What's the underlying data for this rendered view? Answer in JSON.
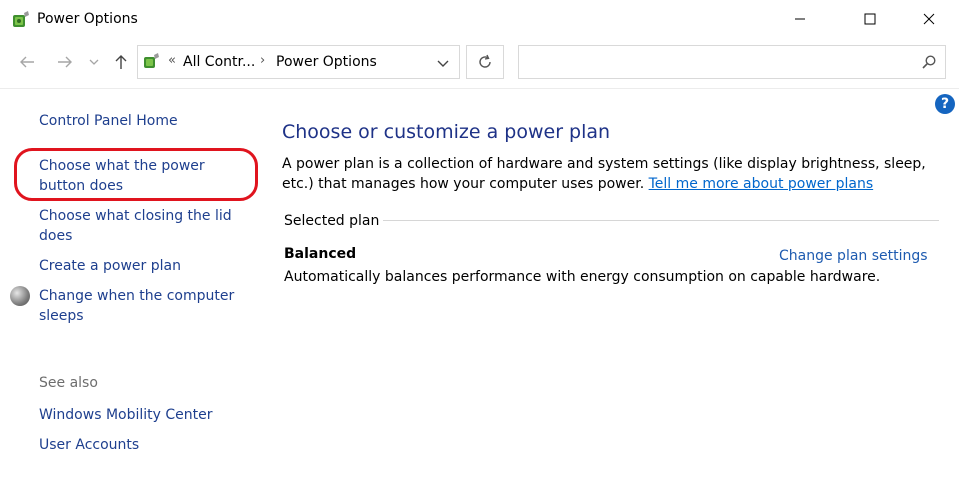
{
  "window": {
    "title": "Power Options"
  },
  "nav": {
    "back_icon": "back-arrow-icon",
    "forward_icon": "forward-arrow-icon",
    "recent_icon": "chevron-down-icon",
    "up_icon": "up-arrow-icon",
    "breadcrumb": [
      "All Contr...",
      "Power Options"
    ],
    "overflow_marker": "«",
    "separator": "›",
    "search_placeholder": ""
  },
  "sidebar": {
    "home": "Control Panel Home",
    "tasks": [
      "Choose what the power button does",
      "Choose what closing the lid does",
      "Create a power plan",
      "Change when the computer sleeps"
    ],
    "see_also_label": "See also",
    "see_also": [
      "Windows Mobility Center",
      "User Accounts"
    ]
  },
  "main": {
    "title": "Choose or customize a power plan",
    "description": "A power plan is a collection of hardware and system settings (like display brightness, sleep, etc.) that manages how your computer uses power.",
    "learn_more": "Tell me more about power plans",
    "selected_plan_label": "Selected plan",
    "plan_name": "Balanced",
    "plan_description": "Automatically balances performance with energy consumption on capable hardware.",
    "change_settings": "Change plan settings"
  },
  "help": {
    "label": "?"
  },
  "colors": {
    "link": "#1e3f8e",
    "title": "#1e3287",
    "highlight": "#e0141e",
    "help": "#1565c0"
  }
}
